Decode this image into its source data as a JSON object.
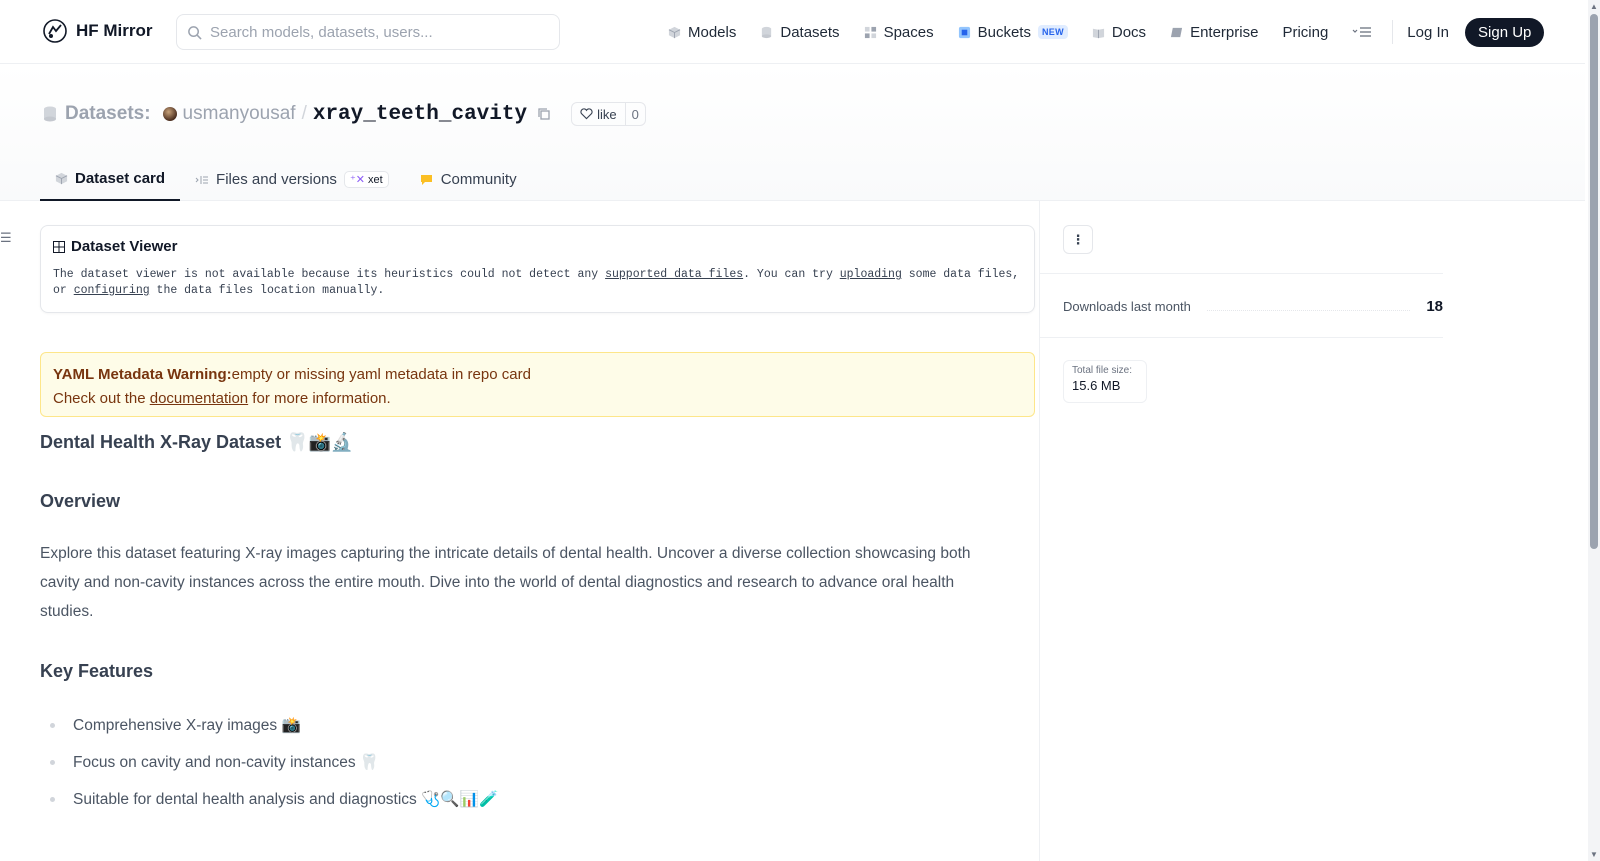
{
  "header": {
    "brand": "HF Mirror",
    "search_placeholder": "Search models, datasets, users...",
    "nav": [
      {
        "label": "Models",
        "icon": "cube-icon"
      },
      {
        "label": "Datasets",
        "icon": "database-icon"
      },
      {
        "label": "Spaces",
        "icon": "grid-icon"
      },
      {
        "label": "Buckets",
        "icon": "bucket-icon",
        "badge": "NEW"
      },
      {
        "label": "Docs",
        "icon": "book-icon"
      },
      {
        "label": "Enterprise",
        "icon": "briefcase-icon"
      },
      {
        "label": "Pricing"
      }
    ],
    "login": "Log In",
    "signup": "Sign Up"
  },
  "repo": {
    "kind": "Datasets:",
    "owner": "usmanyousaf",
    "separator": "/",
    "name": "xray_teeth_cavity",
    "like_label": "like",
    "like_count": "0"
  },
  "tabs": [
    {
      "label": "Dataset card",
      "active": true
    },
    {
      "label": "Files and versions",
      "badge": "xet"
    },
    {
      "label": "Community"
    }
  ],
  "viewer": {
    "title": "Dataset Viewer",
    "text_1": "The dataset viewer is not available because its heuristics could not detect any ",
    "link_1": "supported data files",
    "text_2": ". You can try ",
    "link_2": "uploading",
    "text_3": " some data files, or ",
    "link_3": "configuring",
    "text_4": " the data files location manually."
  },
  "warning": {
    "bold": "YAML Metadata Warning:",
    "text": "empty or missing yaml metadata in repo card",
    "line2_pre": "Check out the ",
    "line2_link": "documentation",
    "line2_post": " for more information."
  },
  "card": {
    "title": "Dental Health X-Ray Dataset 🦷📸🔬",
    "overview_heading": "Overview",
    "overview_text": "Explore this dataset featuring X-ray images capturing the intricate details of dental health. Uncover a diverse collection showcasing both cavity and non-cavity instances across the entire mouth. Dive into the world of dental diagnostics and research to advance oral health studies.",
    "features_heading": "Key Features",
    "features": [
      "Comprehensive X-ray images 📸",
      "Focus on cavity and non-cavity instances 🦷",
      "Suitable for dental health analysis and diagnostics 🩺🔍📊🧪"
    ]
  },
  "sidebar": {
    "downloads_label": "Downloads last month",
    "downloads_value": "18",
    "filesize_label": "Total file size:",
    "filesize_value": "15.6 MB"
  },
  "colors": {
    "accent": "#111827",
    "warning_bg": "#fefce8",
    "warning_text": "#78350f",
    "buckets_blue": "#2563eb"
  }
}
